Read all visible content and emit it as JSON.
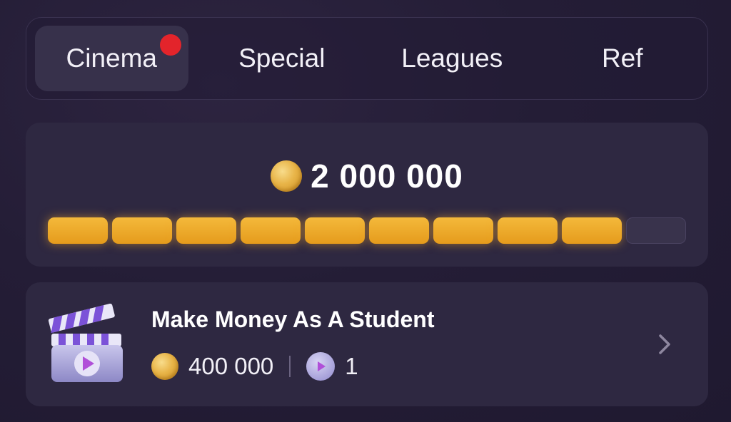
{
  "tabs": [
    {
      "label": "Cinema",
      "active": true,
      "has_notification": true
    },
    {
      "label": "Special",
      "active": false
    },
    {
      "label": "Leagues",
      "active": false
    },
    {
      "label": "Ref",
      "active": false
    }
  ],
  "progress": {
    "reward_amount": "2 000 000",
    "segments_total": 10,
    "segments_filled": 9,
    "icon": "coin-icon"
  },
  "task": {
    "title": "Make Money As A Student",
    "reward": "400 000",
    "videos": "1",
    "icons": [
      "clapperboard-icon",
      "coin-icon",
      "play-icon",
      "chevron-right-icon"
    ]
  },
  "colors": {
    "accent": "#e59b1c",
    "notification": "#e3242b",
    "card": "#2e2841",
    "background": "#241d36"
  }
}
